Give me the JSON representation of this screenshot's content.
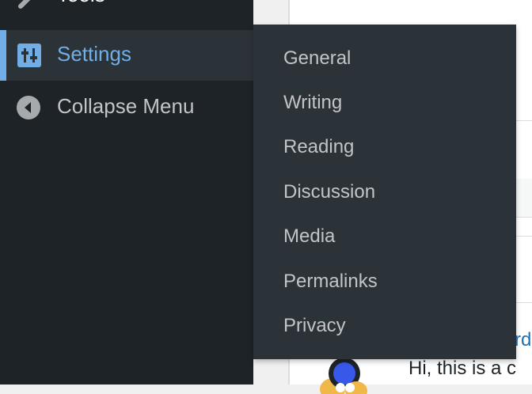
{
  "sidebar": {
    "tools_label": "Tools",
    "settings_label": "Settings",
    "collapse_label": "Collapse Menu",
    "accent_color": "#72aee6"
  },
  "submenu": {
    "items": [
      "General",
      "Writing",
      "Reading",
      "Discussion",
      "Media",
      "Permalinks",
      "Privacy"
    ]
  },
  "content": {
    "comment_author_fragment": "rd",
    "comment_text_fragment": "Hi, this is a c"
  }
}
